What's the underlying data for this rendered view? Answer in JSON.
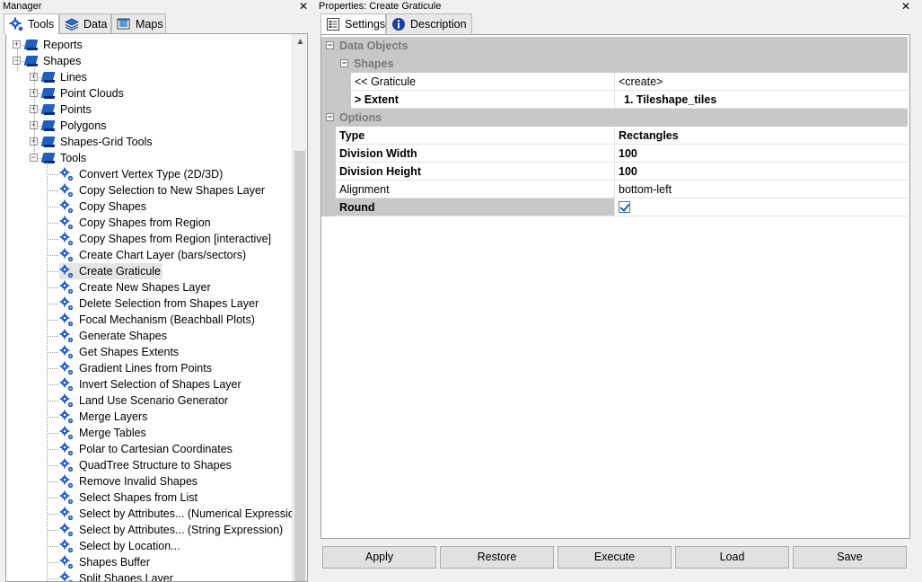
{
  "manager": {
    "title": "Manager",
    "close": "✕",
    "tabs": [
      {
        "label": "Tools",
        "icon": "gear-icon",
        "active": true
      },
      {
        "label": "Data",
        "icon": "layers-icon",
        "active": false
      },
      {
        "label": "Maps",
        "icon": "map-icon",
        "active": false
      }
    ],
    "tree": {
      "groups": [
        {
          "label": "Reports",
          "state": "+"
        },
        {
          "label": "Shapes",
          "state": "−"
        }
      ],
      "subgroups": [
        {
          "label": "Lines",
          "state": "+"
        },
        {
          "label": "Point Clouds",
          "state": "+"
        },
        {
          "label": "Points",
          "state": "+"
        },
        {
          "label": "Polygons",
          "state": "+"
        },
        {
          "label": "Shapes-Grid Tools",
          "state": "+"
        },
        {
          "label": "Tools",
          "state": "−"
        }
      ],
      "tools": [
        "Convert Vertex Type (2D/3D)",
        "Copy Selection to New Shapes Layer",
        "Copy Shapes",
        "Copy Shapes from Region",
        "Copy Shapes from Region [interactive]",
        "Create Chart Layer (bars/sectors)",
        "Create Graticule",
        "Create New Shapes Layer",
        "Delete Selection from Shapes Layer",
        "Focal Mechanism (Beachball Plots)",
        "Generate Shapes",
        "Get Shapes Extents",
        "Gradient Lines from Points",
        "Invert Selection of Shapes Layer",
        "Land Use Scenario Generator",
        "Merge Layers",
        "Merge Tables",
        "Polar to Cartesian Coordinates",
        "QuadTree Structure to Shapes",
        "Remove Invalid Shapes",
        "Select Shapes from List",
        "Select by Attributes... (Numerical Expression)",
        "Select by Attributes... (String Expression)",
        "Select by Location...",
        "Shapes Buffer",
        "Split Shapes Layer"
      ],
      "selected_tool": "Create Graticule"
    },
    "scroll_up": "▲"
  },
  "properties": {
    "title": "Properties: Create Graticule",
    "close": "✕",
    "tabs": [
      {
        "label": "Settings",
        "icon": "settings-icon",
        "active": true
      },
      {
        "label": "Description",
        "icon": "info-icon",
        "active": false
      }
    ],
    "sections": {
      "data_objects": "Data Objects",
      "shapes": "Shapes",
      "options": "Options"
    },
    "rows": {
      "graticule": {
        "name": "<< Graticule",
        "value": "<create>"
      },
      "extent": {
        "name": "> Extent",
        "value": "1. Tileshape_tiles"
      },
      "type": {
        "name": "Type",
        "value": "Rectangles"
      },
      "division_width": {
        "name": "Division Width",
        "value": "100"
      },
      "division_height": {
        "name": "Division Height",
        "value": "100"
      },
      "alignment": {
        "name": "Alignment",
        "value": "bottom-left"
      },
      "round": {
        "name": "Round",
        "checked": true
      }
    },
    "buttons": {
      "apply": "Apply",
      "restore": "Restore",
      "execute": "Execute",
      "load": "Load",
      "save": "Save"
    },
    "collapse_symbol": "−"
  }
}
